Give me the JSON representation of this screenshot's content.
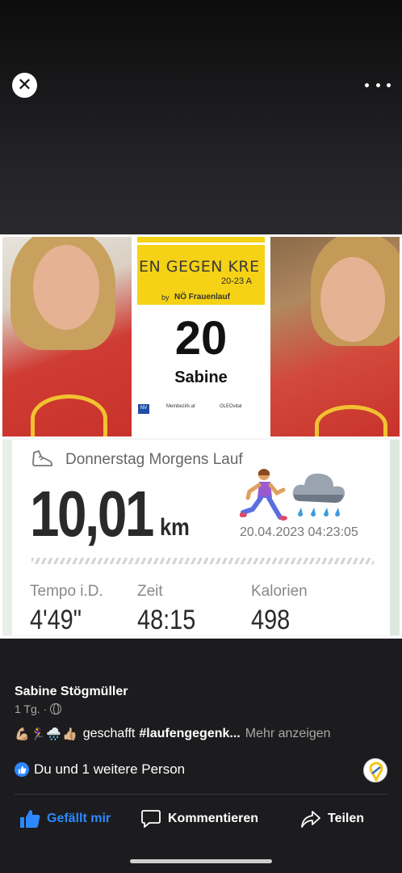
{
  "viewer": {
    "close_icon": "close-icon",
    "more_icon": "more-options-icon"
  },
  "image": {
    "bib": {
      "title": "EN GEGEN KRE",
      "dates": "20-23 A",
      "by": "by",
      "organizer": "NÖ Frauenlauf",
      "number": "20",
      "name": "Sabine",
      "sponsors": [
        "NV",
        "Meinbezirk.at",
        "OLEOvital"
      ]
    },
    "stats": {
      "title": "Donnerstag Morgens Lauf",
      "distance": "10,01",
      "unit": "km",
      "datetime": "20.04.2023 04:23:05",
      "pace_label": "Tempo i.D.",
      "pace_value": "4'49\"",
      "time_label": "Zeit",
      "time_value": "48:15",
      "calories_label": "Kalorien",
      "calories_value": "498"
    }
  },
  "post": {
    "author": "Sabine Stögmüller",
    "age": "1 Tg.",
    "separator": "·",
    "caption_emojis": "💪🏼🏃‍♀️🌧️👍🏼",
    "caption_text": "geschafft",
    "caption_tag": "#laufengegenk...",
    "caption_more": "Mehr anzeigen",
    "likes_text": "Du und 1 weitere Person"
  },
  "actions": {
    "like": "Gefällt mir",
    "comment": "Kommentieren",
    "share": "Teilen"
  },
  "colors": {
    "accent": "#2d88ff",
    "bib_yellow": "#f5d215",
    "background": "#1c1c1e"
  }
}
